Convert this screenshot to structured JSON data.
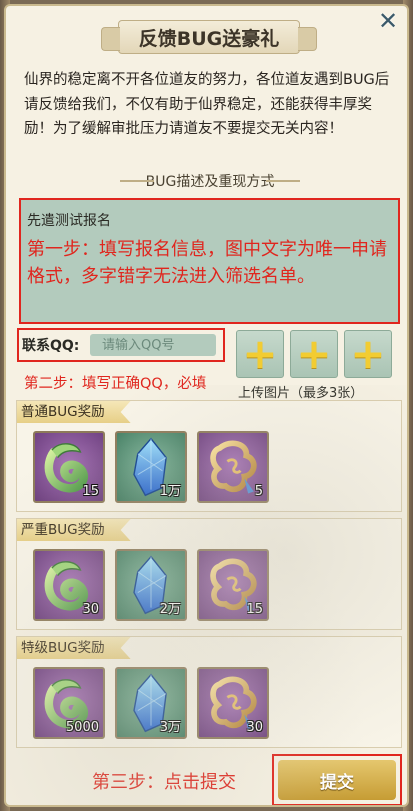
{
  "dialog": {
    "title": "反馈BUG送豪礼",
    "close_icon": "✕",
    "intro": "仙界的稳定离不开各位道友的努力，各位道友遇到BUG后请反馈给我们，不仅有助于仙界稳定，还能获得丰厚奖励！为了缓解审批压力请道友不要提交无关内容！"
  },
  "description": {
    "header": "BUG描述及重现方式",
    "placeholder": "先遣测试报名",
    "step1_annotation": "第一步：填写报名信息，图中文字为唯一申请格式，多字错字无法进入筛选名单。"
  },
  "contact": {
    "label": "联系QQ:",
    "placeholder": "请输入QQ号",
    "value": "",
    "step2_annotation": "第二步：填写正确QQ，必填"
  },
  "upload": {
    "hint": "上传图片（最多3张）",
    "slot_icon": "+"
  },
  "rewards": [
    {
      "title": "普通BUG奖励",
      "items": [
        {
          "icon": "jade-ruyi-icon",
          "quantity": "15",
          "frame": "purple"
        },
        {
          "icon": "blue-crystal-icon",
          "quantity": "1万",
          "frame": "green"
        },
        {
          "icon": "gold-amulet-icon",
          "quantity": "5",
          "frame": "purple"
        }
      ]
    },
    {
      "title": "严重BUG奖励",
      "items": [
        {
          "icon": "jade-ruyi-icon",
          "quantity": "30",
          "frame": "purple"
        },
        {
          "icon": "blue-crystal-icon",
          "quantity": "2万",
          "frame": "green"
        },
        {
          "icon": "gold-amulet-icon",
          "quantity": "15",
          "frame": "purple"
        }
      ]
    },
    {
      "title": "特级BUG奖励",
      "items": [
        {
          "icon": "jade-ruyi-icon",
          "quantity": "5000",
          "frame": "purple"
        },
        {
          "icon": "blue-crystal-icon",
          "quantity": "3万",
          "frame": "green"
        },
        {
          "icon": "gold-amulet-icon",
          "quantity": "30",
          "frame": "purple"
        }
      ]
    }
  ],
  "footer": {
    "step3_annotation": "第三步：点击提交",
    "submit_label": "提交"
  },
  "colors": {
    "annotation_red": "#e0261e",
    "field_green": "#b3cbbd",
    "gold": "#d8b44e"
  }
}
